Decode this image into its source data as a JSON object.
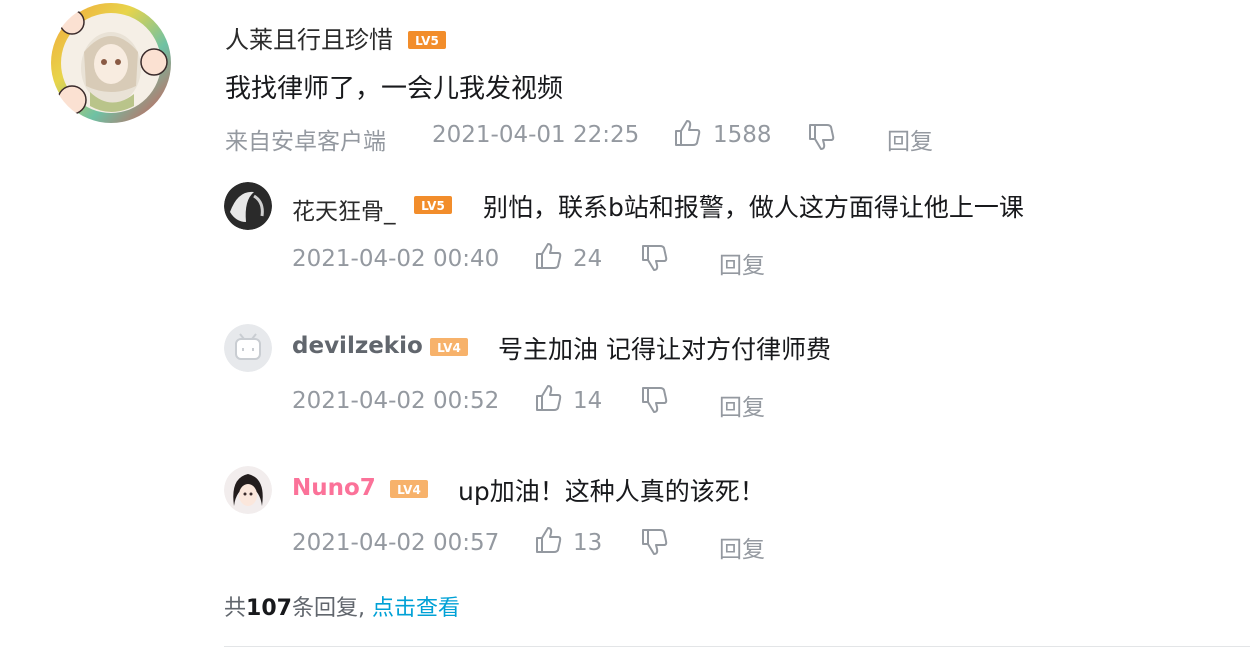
{
  "comment": {
    "username": "人莱且行且珍惜",
    "level": "LV5",
    "text": "我找律师了，一会儿我发视频",
    "source": "来自安卓客户端",
    "timestamp": "2021-04-01 22:25",
    "likes": "1588",
    "reply_label": "回复"
  },
  "replies": [
    {
      "username": "花天狂骨_",
      "level": "LV5",
      "text": "别怕，联系b站和报警，做人这方面得让他上一课",
      "timestamp": "2021-04-02 00:40",
      "likes": "24",
      "reply_label": "回复"
    },
    {
      "username": "devilzekio",
      "level": "LV4",
      "text": "号主加油 记得让对方付律师费",
      "timestamp": "2021-04-02 00:52",
      "likes": "14",
      "reply_label": "回复"
    },
    {
      "username": "Nuno7",
      "level": "LV4",
      "text": "up加油！这种人真的该死！",
      "timestamp": "2021-04-02 00:57",
      "likes": "13",
      "reply_label": "回复"
    }
  ],
  "more_replies": {
    "prefix": "共",
    "count": "107",
    "suffix": "条回复,",
    "link": "点击查看"
  },
  "colors": {
    "lv5": "#f28d2b",
    "lv4": "#f7b26b",
    "vip_name": "#fb7299",
    "link": "#00a1d6",
    "meta": "#9499a0"
  },
  "icons": [
    "like-icon",
    "dislike-icon",
    "level-badge-icon",
    "avatar-icon"
  ]
}
